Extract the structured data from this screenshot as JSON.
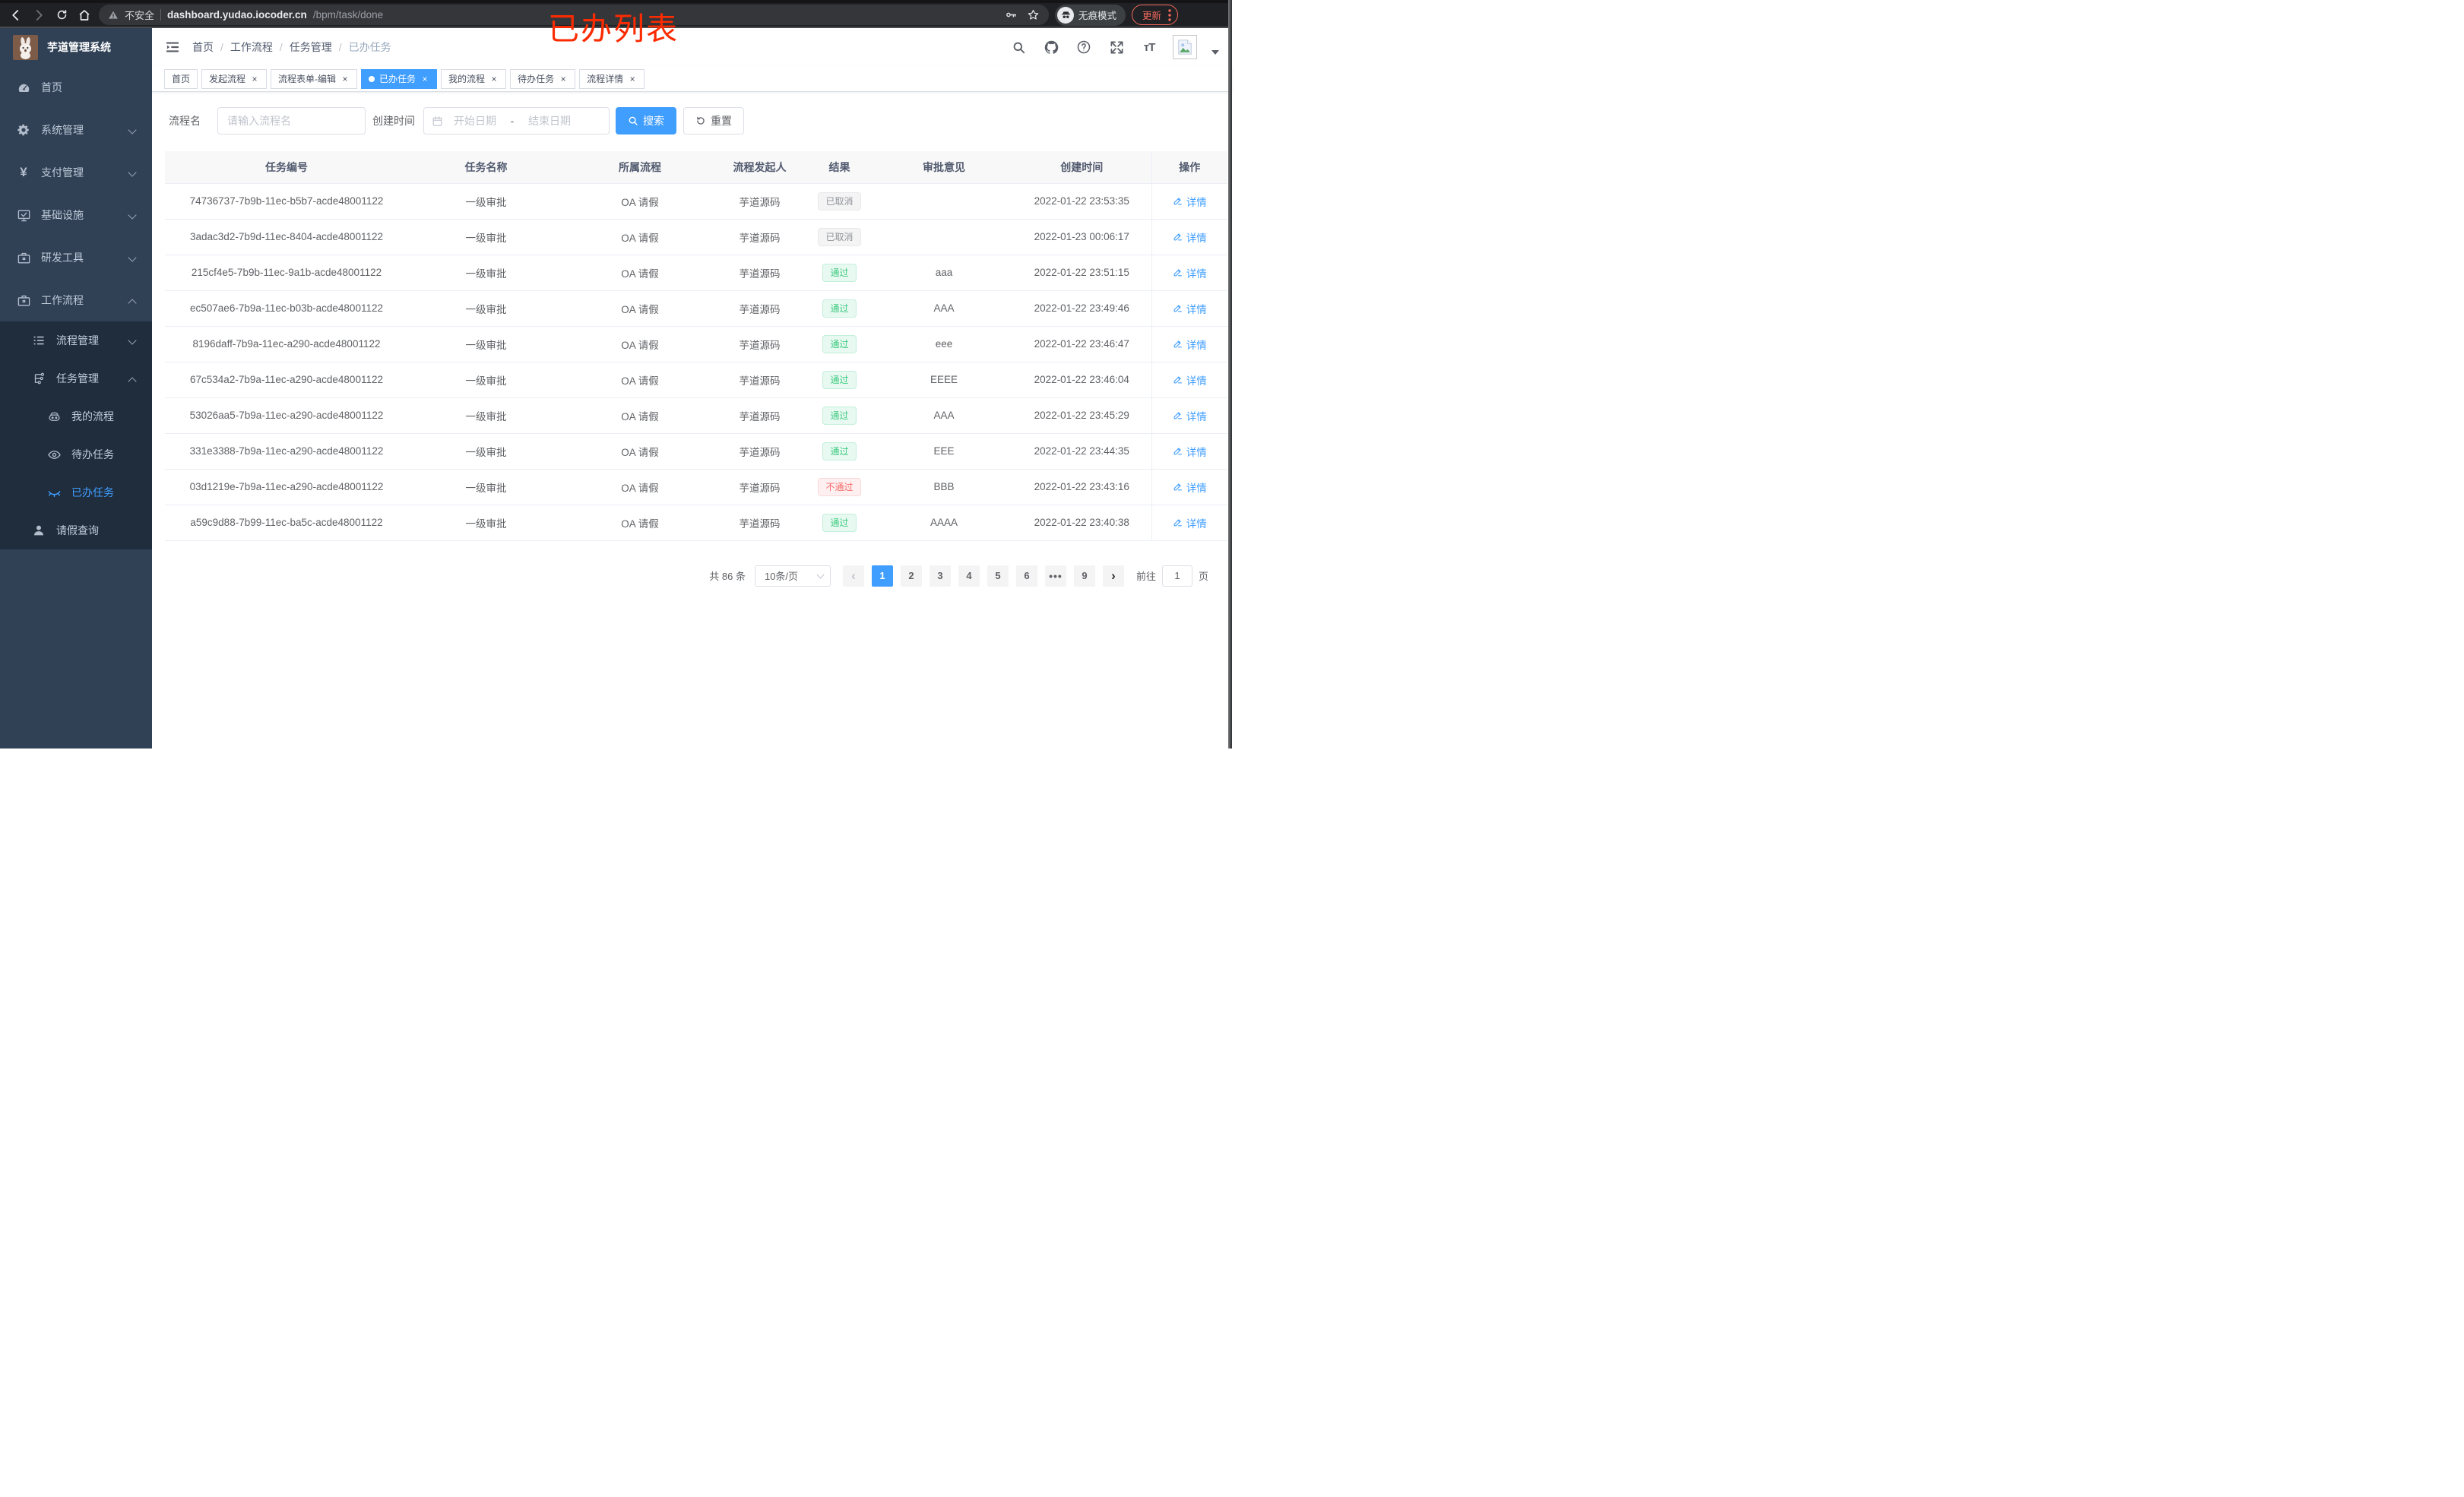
{
  "colors": {
    "accent": "#409eff",
    "sidebar_bg": "#304156",
    "sidebar_sub_bg": "#1f2d3d",
    "success_text": "#3ecb81",
    "danger_text": "#f56c6c",
    "info_text": "#909399",
    "annotation_red": "#fb2b01",
    "active_tab_bg": "#409eff"
  },
  "browser": {
    "security_label": "不安全",
    "url_host": "dashboard.yudao.iocoder.cn",
    "url_path": "/bpm/task/done",
    "incognito_label": "无痕模式",
    "update_label": "更新"
  },
  "annotation": {
    "text": "已办列表"
  },
  "sidebar": {
    "title": "芋道管理系统",
    "menu": [
      {
        "label": "首页",
        "icon": "dashboard-icon",
        "level": "1"
      },
      {
        "label": "系统管理",
        "icon": "gear-icon",
        "level": "1",
        "chevron": "down"
      },
      {
        "label": "支付管理",
        "icon": "yen-icon",
        "level": "1",
        "chevron": "down"
      },
      {
        "label": "基础设施",
        "icon": "monitor-icon",
        "level": "1",
        "chevron": "down"
      },
      {
        "label": "研发工具",
        "icon": "briefcase-icon",
        "level": "1",
        "chevron": "down"
      },
      {
        "label": "工作流程",
        "icon": "briefcase-icon",
        "level": "1",
        "chevron": "up"
      },
      {
        "label": "流程管理",
        "icon": "list-icon",
        "level": "2",
        "sub": "true",
        "chevron": "down"
      },
      {
        "label": "任务管理",
        "icon": "flow-icon",
        "level": "2",
        "sub": "true",
        "chevron": "up"
      },
      {
        "label": "我的流程",
        "icon": "robot-icon",
        "level": "3",
        "sub": "true"
      },
      {
        "label": "待办任务",
        "icon": "eye-icon",
        "level": "3",
        "sub": "true"
      },
      {
        "label": "已办任务",
        "icon": "eye-closed-icon",
        "level": "3",
        "sub": "true",
        "active": "true"
      },
      {
        "label": "请假查询",
        "icon": "user-icon",
        "level": "2",
        "sub": "true"
      }
    ]
  },
  "navbar": {
    "separator": "/",
    "breadcrumb": [
      "首页",
      "工作流程",
      "任务管理",
      "已办任务"
    ]
  },
  "tabs": {
    "close_glyph": "×",
    "items": [
      {
        "label": "首页",
        "closable": "false"
      },
      {
        "label": "发起流程",
        "closable": "true"
      },
      {
        "label": "流程表单-编辑",
        "closable": "true"
      },
      {
        "label": "已办任务",
        "closable": "true",
        "active": "true"
      },
      {
        "label": "我的流程",
        "closable": "true"
      },
      {
        "label": "待办任务",
        "closable": "true"
      },
      {
        "label": "流程详情",
        "closable": "true"
      }
    ]
  },
  "filter": {
    "name_label": "流程名",
    "name_placeholder": "请输入流程名",
    "time_label": "创建时间",
    "start_placeholder": "开始日期",
    "range_separator": "-",
    "end_placeholder": "结束日期",
    "search_label": "搜索",
    "reset_label": "重置"
  },
  "table": {
    "headers": [
      "任务编号",
      "任务名称",
      "所属流程",
      "流程发起人",
      "结果",
      "审批意见",
      "创建时间",
      "操作"
    ],
    "action_label": "详情",
    "rows": [
      {
        "id": "74736737-7b9b-11ec-b5b7-acde48001122",
        "name": "一级审批",
        "process": "OA 请假",
        "starter": "芋道源码",
        "result": "已取消",
        "result_type": "info",
        "comment": "",
        "time": "2022-01-22 23:53:35"
      },
      {
        "id": "3adac3d2-7b9d-11ec-8404-acde48001122",
        "name": "一级审批",
        "process": "OA 请假",
        "starter": "芋道源码",
        "result": "已取消",
        "result_type": "info",
        "comment": "",
        "time": "2022-01-23 00:06:17"
      },
      {
        "id": "215cf4e5-7b9b-11ec-9a1b-acde48001122",
        "name": "一级审批",
        "process": "OA 请假",
        "starter": "芋道源码",
        "result": "通过",
        "result_type": "success",
        "comment": "aaa",
        "time": "2022-01-22 23:51:15"
      },
      {
        "id": "ec507ae6-7b9a-11ec-b03b-acde48001122",
        "name": "一级审批",
        "process": "OA 请假",
        "starter": "芋道源码",
        "result": "通过",
        "result_type": "success",
        "comment": "AAA",
        "time": "2022-01-22 23:49:46"
      },
      {
        "id": "8196daff-7b9a-11ec-a290-acde48001122",
        "name": "一级审批",
        "process": "OA 请假",
        "starter": "芋道源码",
        "result": "通过",
        "result_type": "success",
        "comment": "eee",
        "time": "2022-01-22 23:46:47"
      },
      {
        "id": "67c534a2-7b9a-11ec-a290-acde48001122",
        "name": "一级审批",
        "process": "OA 请假",
        "starter": "芋道源码",
        "result": "通过",
        "result_type": "success",
        "comment": "EEEE",
        "time": "2022-01-22 23:46:04"
      },
      {
        "id": "53026aa5-7b9a-11ec-a290-acde48001122",
        "name": "一级审批",
        "process": "OA 请假",
        "starter": "芋道源码",
        "result": "通过",
        "result_type": "success",
        "comment": "AAA",
        "time": "2022-01-22 23:45:29"
      },
      {
        "id": "331e3388-7b9a-11ec-a290-acde48001122",
        "name": "一级审批",
        "process": "OA 请假",
        "starter": "芋道源码",
        "result": "通过",
        "result_type": "success",
        "comment": "EEE",
        "time": "2022-01-22 23:44:35"
      },
      {
        "id": "03d1219e-7b9a-11ec-a290-acde48001122",
        "name": "一级审批",
        "process": "OA 请假",
        "starter": "芋道源码",
        "result": "不通过",
        "result_type": "danger",
        "comment": "BBB",
        "time": "2022-01-22 23:43:16"
      },
      {
        "id": "a59c9d88-7b99-11ec-ba5c-acde48001122",
        "name": "一级审批",
        "process": "OA 请假",
        "starter": "芋道源码",
        "result": "通过",
        "result_type": "success",
        "comment": "AAAA",
        "time": "2022-01-22 23:40:38"
      }
    ]
  },
  "pagination": {
    "total_label": "共 86 条",
    "page_size": "10条/页",
    "pages": [
      {
        "label": "‹",
        "type": "prev"
      },
      {
        "label": "1",
        "type": "active"
      },
      {
        "label": "2",
        "type": "page"
      },
      {
        "label": "3",
        "type": "page"
      },
      {
        "label": "4",
        "type": "page"
      },
      {
        "label": "5",
        "type": "page"
      },
      {
        "label": "6",
        "type": "page"
      },
      {
        "label": "•••",
        "type": "ellipsis"
      },
      {
        "label": "9",
        "type": "page"
      },
      {
        "label": "›",
        "type": "next"
      }
    ],
    "goto_label": "前往",
    "goto_value": "1",
    "goto_unit": "页"
  }
}
